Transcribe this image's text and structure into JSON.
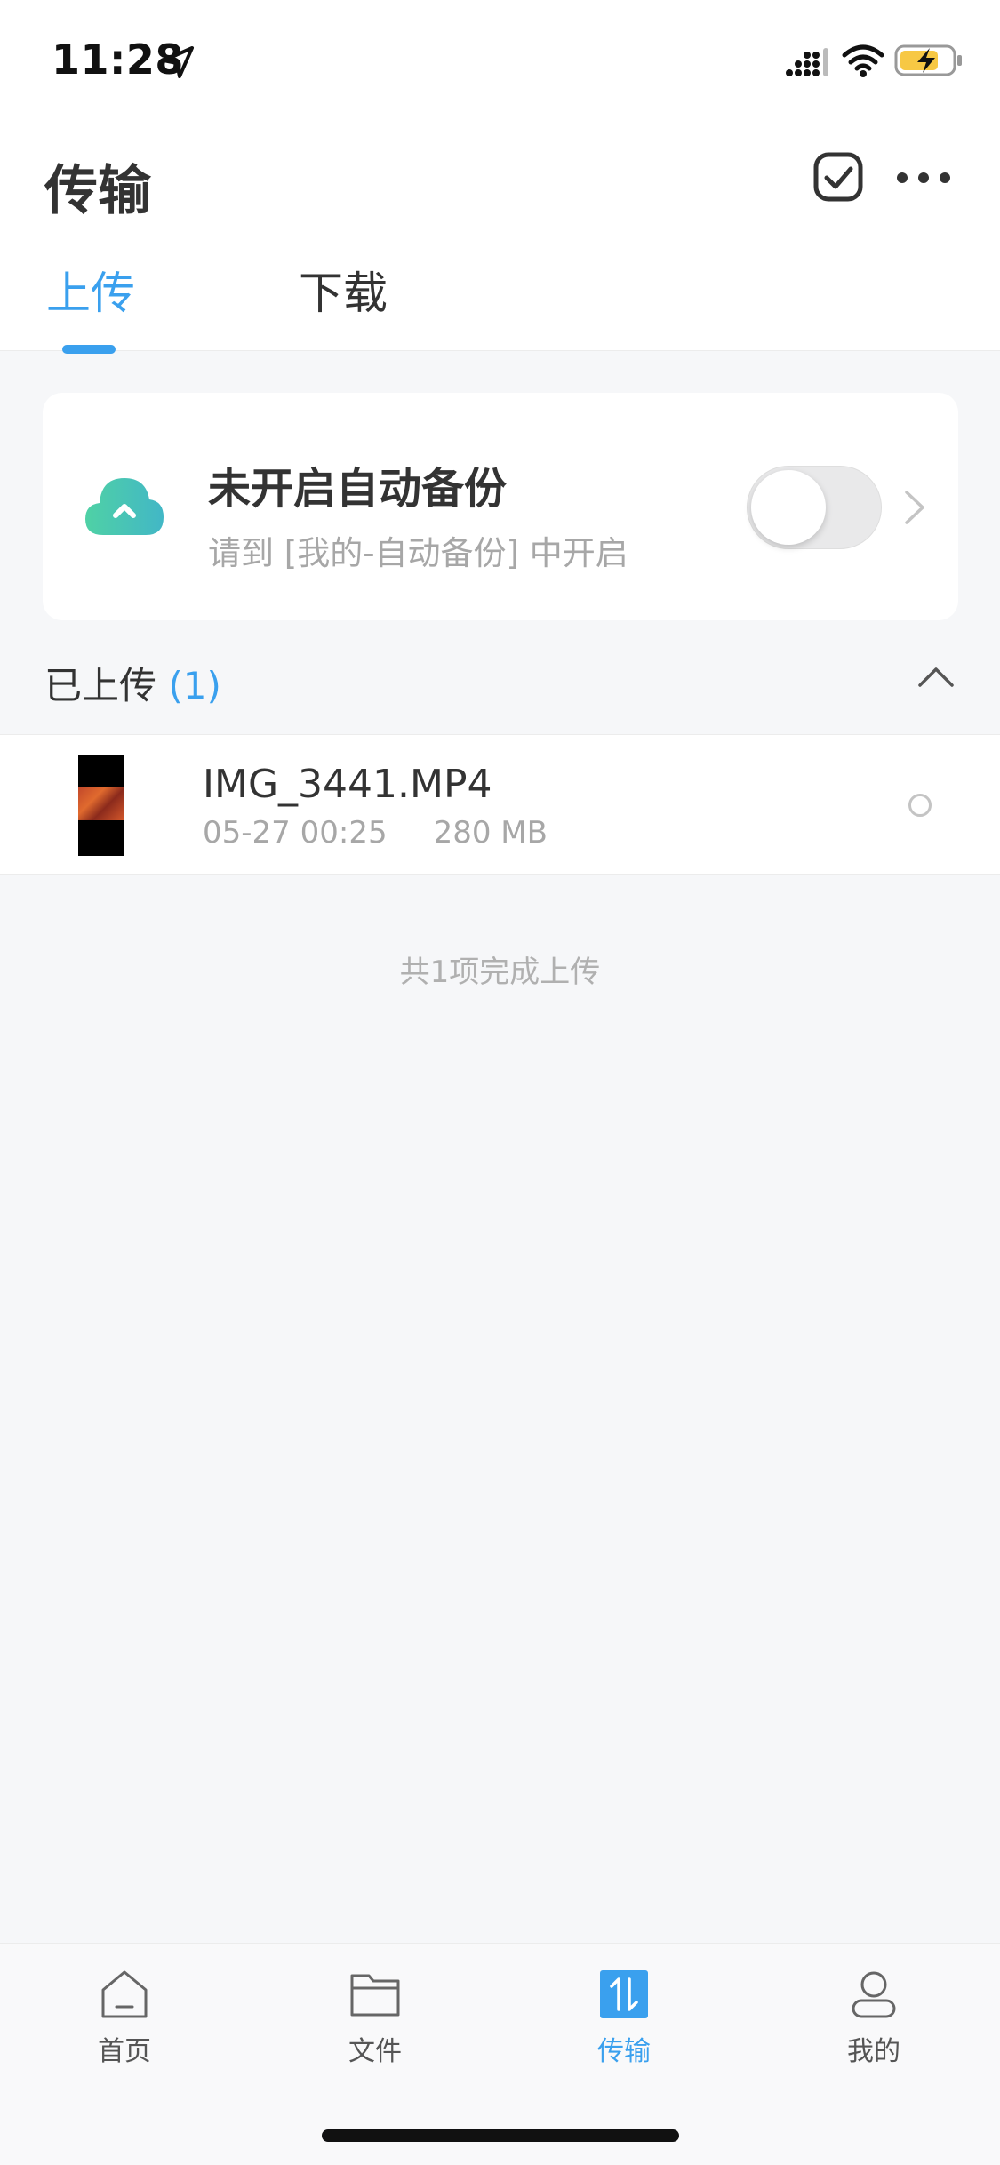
{
  "status_bar": {
    "time": "11:28"
  },
  "header": {
    "title": "传输",
    "tabs": [
      {
        "label": "上传",
        "active": true
      },
      {
        "label": "下载",
        "active": false
      }
    ]
  },
  "backup_card": {
    "title": "未开启自动备份",
    "subtitle": "请到 [我的-自动备份] 中开启",
    "toggle_on": false
  },
  "section": {
    "label": "已上传",
    "count": "(1)"
  },
  "files": [
    {
      "name": "IMG_3441.MP4",
      "date": "05-27 00:25",
      "size": "280 MB"
    }
  ],
  "complete_note": "共1项完成上传",
  "tabbar": {
    "items": [
      {
        "label": "首页",
        "icon": "home-icon"
      },
      {
        "label": "文件",
        "icon": "folder-icon"
      },
      {
        "label": "传输",
        "icon": "transfer-icon",
        "active": true
      },
      {
        "label": "我的",
        "icon": "profile-icon"
      }
    ]
  },
  "colors": {
    "accent": "#3aa0ee",
    "cloud_start": "#4fd1a5",
    "cloud_end": "#42b7c6"
  }
}
